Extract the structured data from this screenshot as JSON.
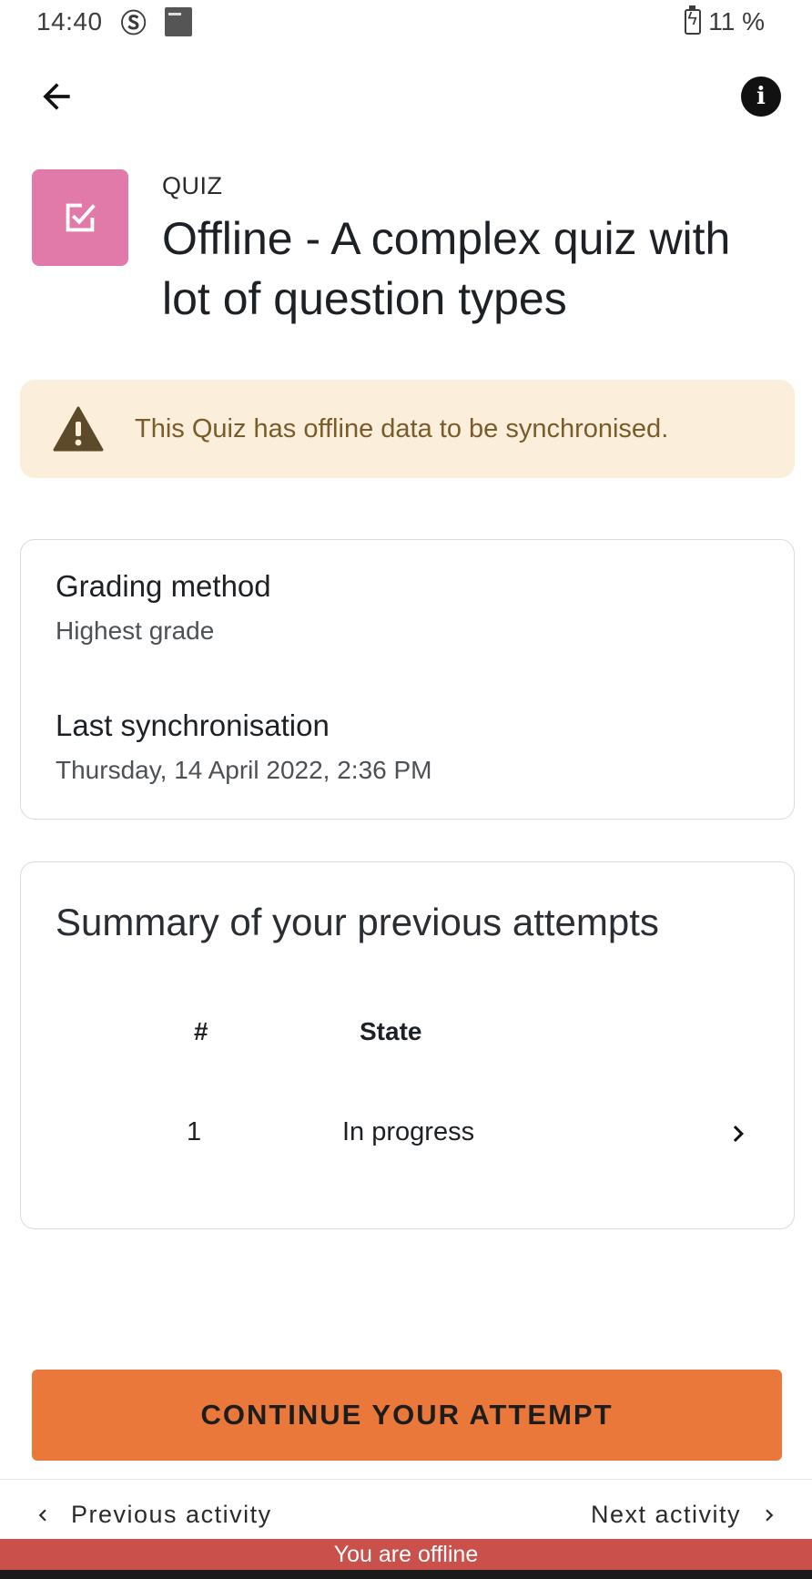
{
  "status_bar": {
    "time": "14:40",
    "battery": "11 %"
  },
  "header": {
    "module_type": "QUIZ",
    "title": "Offline - A complex quiz with lot of question types"
  },
  "warning": {
    "text": "This Quiz has offline data to be synchronised."
  },
  "info": {
    "grading_label": "Grading method",
    "grading_value": "Highest grade",
    "sync_label": "Last synchronisation",
    "sync_value": "Thursday, 14 April 2022, 2:36 PM"
  },
  "attempts": {
    "title": "Summary of your previous attempts",
    "columns": [
      "#",
      "State"
    ],
    "rows": [
      {
        "number": "1",
        "state": "In progress"
      }
    ]
  },
  "actions": {
    "continue_label": "CONTINUE YOUR ATTEMPT"
  },
  "bottom_nav": {
    "previous_label": "Previous activity",
    "next_label": "Next activity"
  },
  "offline_banner": "You are offline",
  "colors": {
    "quiz_icon_bg": "#e17aa8",
    "warning_bg": "#fbefdc",
    "warning_icon": "#5c4a2a",
    "primary_button": "#e9783a",
    "offline_banner": "#c9504b"
  }
}
